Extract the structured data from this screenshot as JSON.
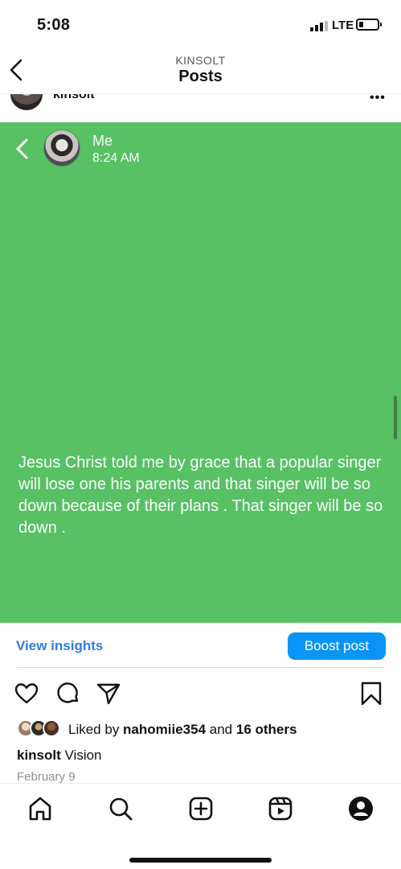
{
  "status_bar": {
    "time": "5:08",
    "network": "LTE"
  },
  "header": {
    "account": "KINSOLT",
    "title": "Posts"
  },
  "post_header": {
    "username": "kinsolt",
    "more": "•••"
  },
  "story": {
    "author": "Me",
    "time": "8:24 AM",
    "background_color": "#57c164",
    "text": "Jesus Christ told me by grace that a popular singer will lose one his parents and that singer will be so down because of their plans .  That singer will be so down ."
  },
  "insights": {
    "view_insights_label": "View insights",
    "boost_label": "Boost post"
  },
  "likes": {
    "prefix": "Liked by ",
    "user": "nahomiie354",
    "middle": " and ",
    "others": "16 others"
  },
  "caption": {
    "username": "kinsolt",
    "text": " Vision"
  },
  "date": "February 9",
  "icons": {
    "header": [
      "back-icon"
    ],
    "actions": [
      "heart-icon",
      "comment-icon",
      "share-icon",
      "bookmark-icon"
    ],
    "nav": [
      "home-icon",
      "search-icon",
      "create-icon",
      "reels-icon",
      "profile-icon"
    ]
  },
  "colors": {
    "accent": "#0a95f6",
    "link": "#2f7de1",
    "story_bg": "#57c164"
  }
}
